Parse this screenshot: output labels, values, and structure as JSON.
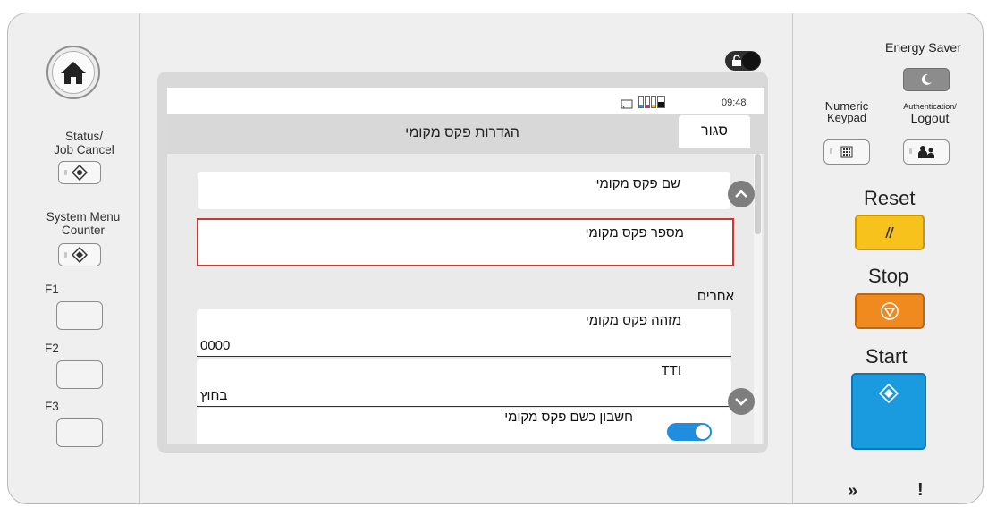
{
  "left_panel": {
    "status_label_line1": "Status/",
    "status_label_line2": "Job Cancel",
    "system_menu_line1": "System Menu",
    "system_menu_line2": "Counter",
    "f1": "F1",
    "f2": "F2",
    "f3": "F3"
  },
  "screen": {
    "time": "09:48",
    "close_label": "סגור",
    "title": "הגדרות פקס מקומי",
    "rows": {
      "local_fax_name": "שם פקס מקומי",
      "local_fax_number": "מספר פקס מקומי",
      "others_header": "אחרים",
      "local_fax_id_label": "מזהה פקס מקומי",
      "local_fax_id_value": "0000",
      "tti_label": "TTI",
      "tti_value": "בחוץ",
      "account_label": "חשבון כשם פקס מקומי"
    },
    "selected_border_color": "#d93030",
    "toggle_color": "#1f8ee0"
  },
  "right_panel": {
    "energy_saver": "Energy Saver",
    "numeric_line1": "Numeric",
    "numeric_line2": "Keypad",
    "auth_line1": "Authentication/",
    "auth_line2": "Logout",
    "reset": "Reset",
    "stop": "Stop",
    "start": "Start",
    "reset_color": "#f7c21b",
    "stop_color": "#f08a1e",
    "start_color": "#1a9be0",
    "bottom_arrows": "»",
    "bottom_alert": "!"
  }
}
